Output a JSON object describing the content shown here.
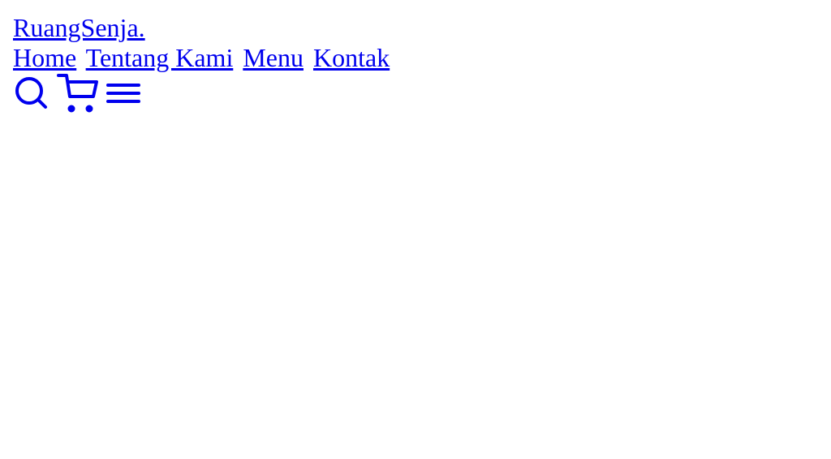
{
  "navbar": {
    "logo": "RuangSenja.",
    "links": [
      {
        "label": "Home"
      },
      {
        "label": "Tentang Kami"
      },
      {
        "label": "Menu"
      },
      {
        "label": "Kontak"
      }
    ],
    "icons": [
      {
        "name": "search-icon"
      },
      {
        "name": "shopping-cart-icon"
      },
      {
        "name": "hamburger-menu-icon"
      }
    ]
  },
  "colors": {
    "link": "#0000ee",
    "background": "#ffffff"
  }
}
